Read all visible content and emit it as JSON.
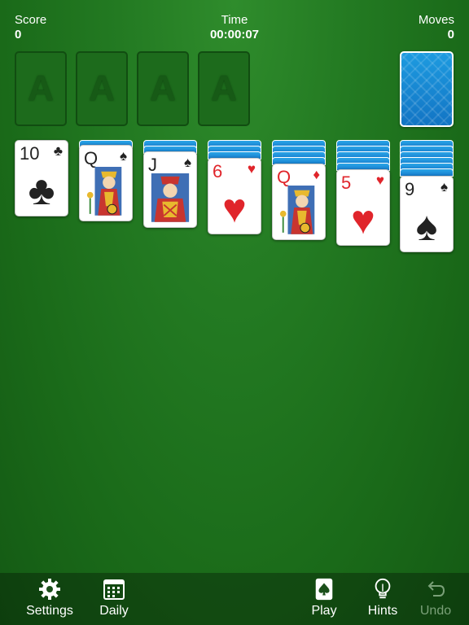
{
  "hud": {
    "score_label": "Score",
    "score_value": "0",
    "time_label": "Time",
    "time_value": "00:00:07",
    "moves_label": "Moves",
    "moves_value": "0"
  },
  "foundations": [
    "A",
    "A",
    "A",
    "A"
  ],
  "tableau": [
    {
      "rank": "10",
      "suit": "♣",
      "color": "black"
    },
    {
      "rank": "Q",
      "suit": "♠",
      "color": "black"
    },
    {
      "rank": "J",
      "suit": "♠",
      "color": "black"
    },
    {
      "rank": "6",
      "suit": "♥",
      "color": "red"
    },
    {
      "rank": "Q",
      "suit": "♦",
      "color": "red"
    },
    {
      "rank": "5",
      "suit": "♥",
      "color": "red"
    },
    {
      "rank": "9",
      "suit": "♠",
      "color": "black"
    }
  ],
  "toolbar": {
    "settings_label": "Settings",
    "daily_label": "Daily",
    "play_label": "Play",
    "hints_label": "Hints",
    "undo_label": "Undo"
  },
  "colors": {
    "felt": "#1f731e",
    "card_back": "#1a8ad6",
    "red_suit": "#e0252b"
  }
}
